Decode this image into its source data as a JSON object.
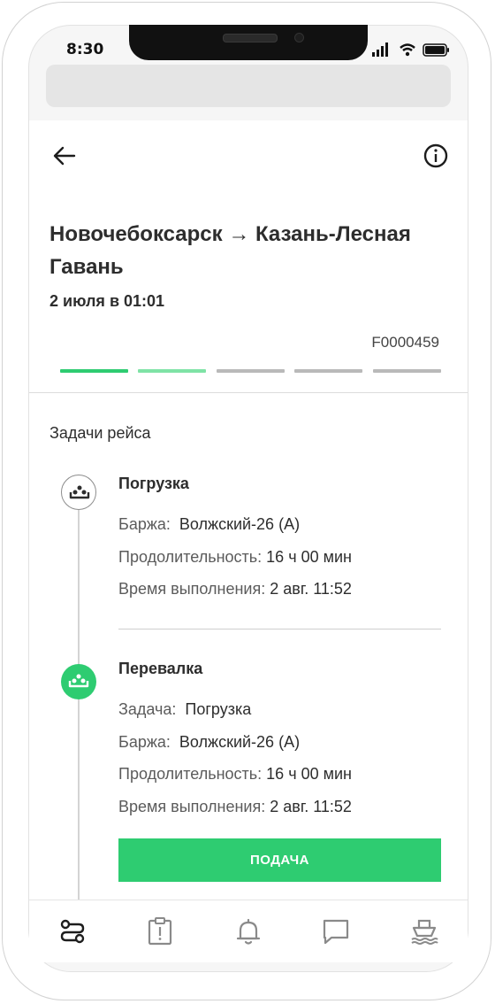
{
  "status_bar": {
    "time": "8:30"
  },
  "header": {
    "back_icon": "arrow-left-icon",
    "info_icon": "info-circle-icon"
  },
  "route": {
    "title": "Новочебоксарск → Казань-Лесная Гавань",
    "date": "2 июля в 01:01",
    "code": "F0000459"
  },
  "progress": {
    "total_steps": 5,
    "completed_steps": 1,
    "current_step": 2
  },
  "colors": {
    "accent": "#2ecc71",
    "accent_light": "#7fe3a6",
    "inactive": "#b9b9b9"
  },
  "tasks": {
    "heading": "Задачи рейса",
    "items": [
      {
        "title": "Погрузка",
        "status": "inactive",
        "barge_label": "Баржа:",
        "barge_value": "Волжский-26 (А)",
        "duration_label": "Продолительность:",
        "duration_value": "16 ч 00 мин",
        "time_label": "Время выполнения:",
        "time_value": "2 авг. 11:52"
      },
      {
        "title": "Перевалка",
        "status": "active",
        "task_label": "Задача:",
        "task_value": "Погрузка",
        "barge_label": "Баржа:",
        "barge_value": "Волжский-26 (А)",
        "duration_label": "Продолительность:",
        "duration_value": "16 ч 00 мин",
        "time_label": "Время выполнения:",
        "time_value": "2 авг. 11:52",
        "button_label": "ПОДАЧА"
      }
    ]
  },
  "bottom_nav": {
    "items": [
      {
        "icon": "route-icon",
        "active": true
      },
      {
        "icon": "clipboard-alert-icon",
        "active": false
      },
      {
        "icon": "bell-icon",
        "active": false
      },
      {
        "icon": "chat-icon",
        "active": false
      },
      {
        "icon": "ship-icon",
        "active": false
      }
    ]
  }
}
